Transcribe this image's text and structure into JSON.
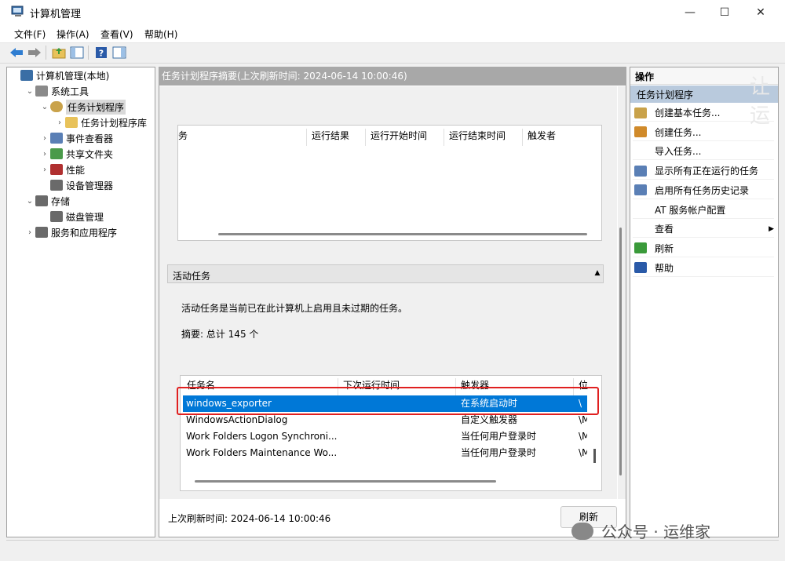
{
  "window": {
    "title": "计算机管理",
    "minimize": "—",
    "maximize": "☐",
    "close": "✕"
  },
  "menu": [
    "文件(F)",
    "操作(A)",
    "查看(V)",
    "帮助(H)"
  ],
  "tree": [
    {
      "label": "计算机管理(本地)",
      "level": 0,
      "chev": ""
    },
    {
      "label": "系统工具",
      "level": 1,
      "chev": "⌄"
    },
    {
      "label": "任务计划程序",
      "level": 2,
      "chev": "⌄"
    },
    {
      "label": "任务计划程序库",
      "level": 3,
      "chev": "›"
    },
    {
      "label": "事件查看器",
      "level": 2,
      "chev": "›"
    },
    {
      "label": "共享文件夹",
      "level": 2,
      "chev": "›"
    },
    {
      "label": "性能",
      "level": 2,
      "chev": "›"
    },
    {
      "label": "设备管理器",
      "level": 2,
      "chev": ""
    },
    {
      "label": "存储",
      "level": 1,
      "chev": "⌄"
    },
    {
      "label": "磁盘管理",
      "level": 2,
      "chev": ""
    },
    {
      "label": "服务和应用程序",
      "level": 1,
      "chev": "›"
    }
  ],
  "center": {
    "header": "任务计划程序摘要(上次刷新时间: 2024-06-14 10:00:46)",
    "top_columns": [
      "务",
      "运行结果",
      "运行开始时间",
      "运行结束时间",
      "触发者"
    ],
    "section_title": "活动任务",
    "section_desc": "活动任务是当前已在此计算机上启用且未过期的任务。",
    "summary": "摘要: 总计 145 个",
    "task_columns": [
      "任务名",
      "下次运行时间",
      "触发器",
      "位"
    ],
    "tasks": [
      {
        "name": "windows_exporter",
        "next": "",
        "trigger": "在系统启动时",
        "loc": "\\"
      },
      {
        "name": "WindowsActionDialog",
        "next": "",
        "trigger": "自定义触发器",
        "loc": "\\M"
      },
      {
        "name": "Work Folders Logon Synchroni...",
        "next": "",
        "trigger": "当任何用户登录时",
        "loc": "\\M"
      },
      {
        "name": "Work Folders Maintenance Wo...",
        "next": "",
        "trigger": "当任何用户登录时",
        "loc": "\\M"
      }
    ],
    "last_refresh": "上次刷新时间: 2024-06-14 10:00:46",
    "refresh_button": "刷新"
  },
  "actions": {
    "header": "操作",
    "sub": "任务计划程序",
    "items": [
      {
        "label": "创建基本任务...",
        "icon": "clock-icon"
      },
      {
        "label": "创建任务...",
        "icon": "task-icon"
      },
      {
        "label": "导入任务...",
        "icon": ""
      },
      {
        "label": "显示所有正在运行的任务",
        "icon": "list-icon"
      },
      {
        "label": "启用所有任务历史记录",
        "icon": "history-icon"
      },
      {
        "label": "AT 服务帐户配置",
        "icon": ""
      },
      {
        "label": "查看",
        "icon": "",
        "submenu": true
      },
      {
        "label": "刷新",
        "icon": "refresh-icon"
      },
      {
        "label": "帮助",
        "icon": "help-icon"
      }
    ]
  },
  "watermark": "公众号 · 运维家",
  "corner_text": "让运"
}
